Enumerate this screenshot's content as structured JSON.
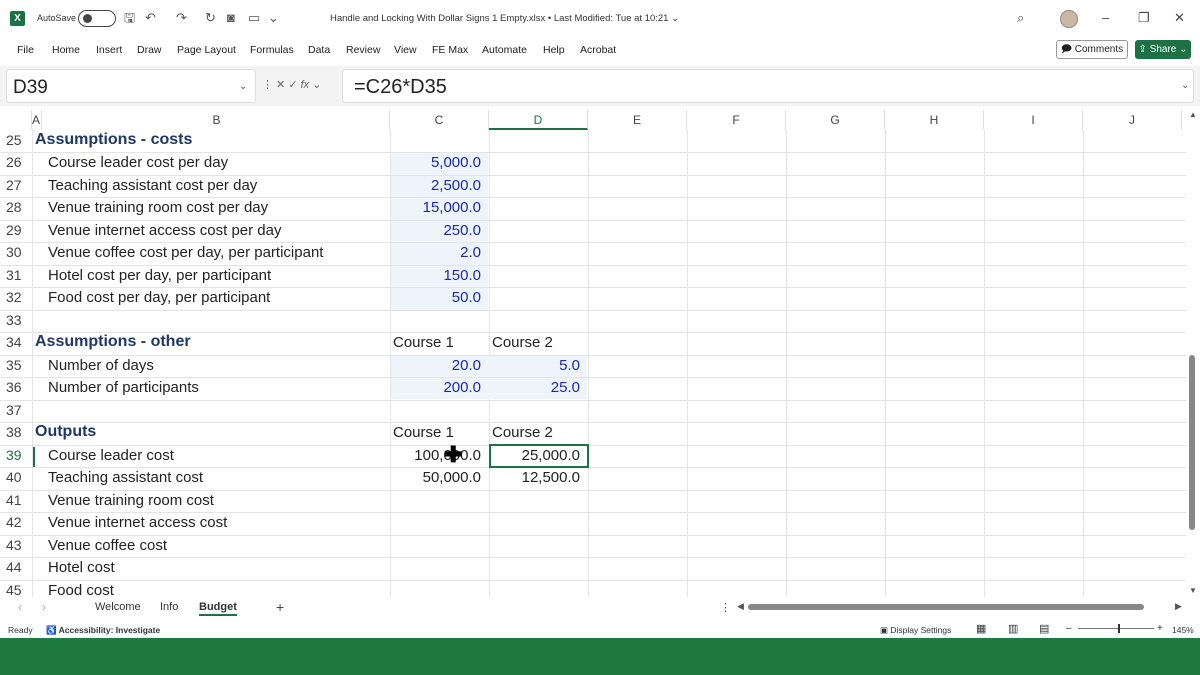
{
  "titlebar": {
    "autosave_label": "AutoSave",
    "doc_title": "Handle and Locking With Dollar Signs 1 Empty.xlsx • Last Modified: Tue at 10:21 ⌄"
  },
  "ribbon": {
    "tabs": [
      "File",
      "Home",
      "Insert",
      "Draw",
      "Page Layout",
      "Formulas",
      "Data",
      "Review",
      "View",
      "FE Max",
      "Automate",
      "Help",
      "Acrobat"
    ],
    "comments_label": "Comments",
    "share_label": "Share"
  },
  "formula_bar": {
    "name_box": "D39",
    "fx": "fx",
    "formula": "=C26*D35"
  },
  "grid": {
    "columns": [
      "A",
      "B",
      "C",
      "D",
      "E",
      "F",
      "G",
      "H",
      "I",
      "J"
    ],
    "rows": {
      "r25": {
        "num": "25",
        "a": "Assumptions - costs"
      },
      "r26": {
        "num": "26",
        "b": "Course leader cost per day",
        "c": "5,000.0"
      },
      "r27": {
        "num": "27",
        "b": "Teaching assistant cost per day",
        "c": "2,500.0"
      },
      "r28": {
        "num": "28",
        "b": "Venue training room cost per day",
        "c": "15,000.0"
      },
      "r29": {
        "num": "29",
        "b": "Venue internet access cost per day",
        "c": "250.0"
      },
      "r30": {
        "num": "30",
        "b": "Venue coffee cost per day, per participant",
        "c": "2.0"
      },
      "r31": {
        "num": "31",
        "b": "Hotel cost per day, per participant",
        "c": "150.0"
      },
      "r32": {
        "num": "32",
        "b": "Food cost per day, per participant",
        "c": "50.0"
      },
      "r33": {
        "num": "33"
      },
      "r34": {
        "num": "34",
        "a": "Assumptions - other",
        "c": "Course 1",
        "d": "Course 2"
      },
      "r35": {
        "num": "35",
        "b": "Number of days",
        "c": "20.0",
        "d": "5.0"
      },
      "r36": {
        "num": "36",
        "b": "Number of participants",
        "c": "200.0",
        "d": "25.0"
      },
      "r37": {
        "num": "37"
      },
      "r38": {
        "num": "38",
        "a": "Outputs",
        "c": "Course 1",
        "d": "Course 2"
      },
      "r39": {
        "num": "39",
        "b": "Course leader cost",
        "c": "100,000.0",
        "d": "25,000.0"
      },
      "r40": {
        "num": "40",
        "b": "Teaching assistant cost",
        "c": "50,000.0",
        "d": "12,500.0"
      },
      "r41": {
        "num": "41",
        "b": "Venue training room cost"
      },
      "r42": {
        "num": "42",
        "b": "Venue internet access cost"
      },
      "r43": {
        "num": "43",
        "b": "Venue coffee cost"
      },
      "r44": {
        "num": "44",
        "b": "Hotel cost"
      },
      "r45": {
        "num": "45",
        "b": "Food cost"
      }
    }
  },
  "sheet_tabs": [
    "Welcome",
    "Info",
    "Budget"
  ],
  "active_sheet": "Budget",
  "status": {
    "ready": "Ready",
    "accessibility": "Accessibility: Investigate",
    "display_settings": "Display Settings",
    "zoom": "145%"
  },
  "colors": {
    "accent": "#1e7145",
    "heading": "#1f3864",
    "input_blue": "#1a2aa8",
    "input_fill": "#eef4fb"
  }
}
